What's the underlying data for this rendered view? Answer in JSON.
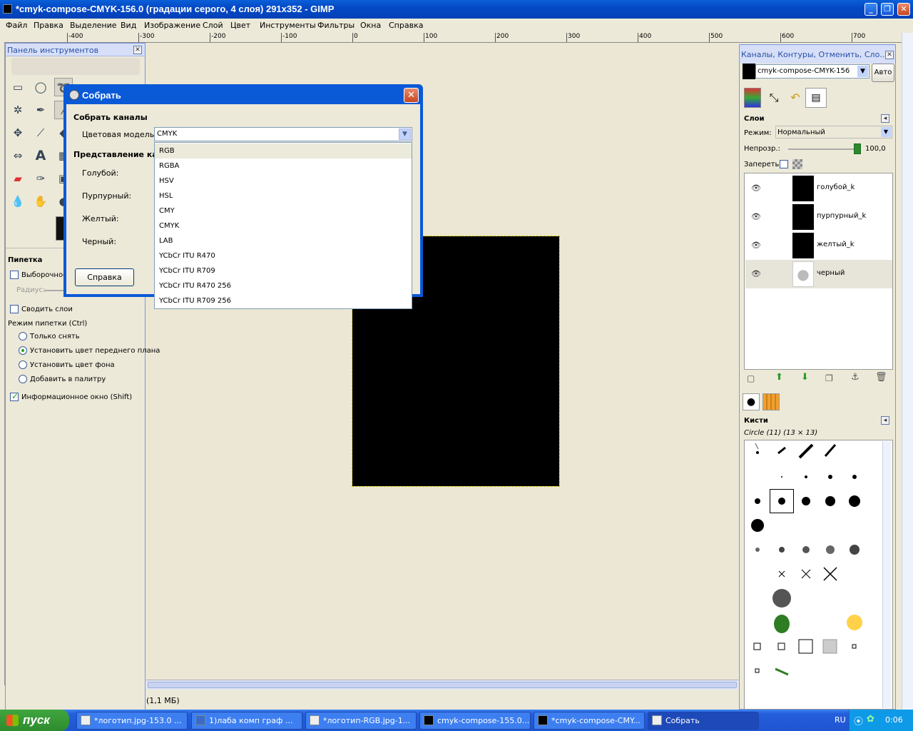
{
  "window": {
    "title": "*cmyk-compose-CMYK-156.0 (градации серого, 4 слоя) 291x352 - GIMP"
  },
  "menu": [
    "Файл",
    "Правка",
    "Выделение",
    "Вид",
    "Изображение",
    "Слой",
    "Цвет",
    "Инструменты",
    "Фильтры",
    "Окна",
    "Справка"
  ],
  "ruler": [
    "-400",
    "-300",
    "-200",
    "-100",
    "0",
    "100",
    "200",
    "300",
    "400",
    "500",
    "600",
    "700"
  ],
  "status": {
    "size_text": "(1,1 МБ)"
  },
  "toolbox": {
    "title": "Панель инструментов",
    "tool_options_title": "Пипетка",
    "sample_average": "Выборочное с",
    "radius_label": "Радиус:",
    "merge_layers": "Сводить слои",
    "mode_label": "Режим пипетки (Ctrl)",
    "modes": [
      "Только снять",
      "Установить цвет переднего плана",
      "Установить цвет фона",
      "Добавить в палитру"
    ],
    "info_window": "Информационное окно (Shift)"
  },
  "dialog": {
    "title": "Собрать",
    "section_compose": "Собрать каналы",
    "color_model_label": "Цветовая модель:",
    "color_model_value": "CMYK",
    "section_channels": "Представление кан",
    "channels": [
      "Голубой:",
      "Пурпурный:",
      "Желтый:",
      "Черный:"
    ],
    "help_button": "Справка",
    "options": [
      "RGB",
      "RGBA",
      "HSV",
      "HSL",
      "CMY",
      "CMYK",
      "LAB",
      "YCbCr ITU R470",
      "YCbCr ITU R709",
      "YCbCr ITU R470 256",
      "YCbCr ITU R709 256"
    ]
  },
  "dock": {
    "title": "Каналы, Контуры, Отменить, Сло...",
    "image_select": "cmyk-compose-CMYK-156",
    "auto_button": "Авто",
    "layers_title": "Слои",
    "mode_label": "Режим:",
    "mode_value": "Нормальный",
    "opacity_label": "Непрозр.:",
    "opacity_value": "100,0",
    "lock_label": "Запереть:",
    "layers": [
      "голубой_k",
      "пурпурный_k",
      "желтый_k",
      "черный"
    ],
    "brushes_title": "Кисти",
    "brush_name": "Circle (11) (13 × 13)"
  },
  "taskbar": {
    "start": "пуск",
    "tasks": [
      "*логотип.jpg-153.0 ...",
      "1)лаба комп граф ...",
      "*логотип-RGB.jpg-1...",
      "cmyk-compose-155.0...",
      "*cmyk-compose-CMY...",
      "Собрать"
    ],
    "lang": "RU",
    "clock": "0:06"
  },
  "colors": {
    "titlebar": "#0449c6",
    "dock_border": "#7a96df",
    "start_green": "#3fa63f"
  }
}
